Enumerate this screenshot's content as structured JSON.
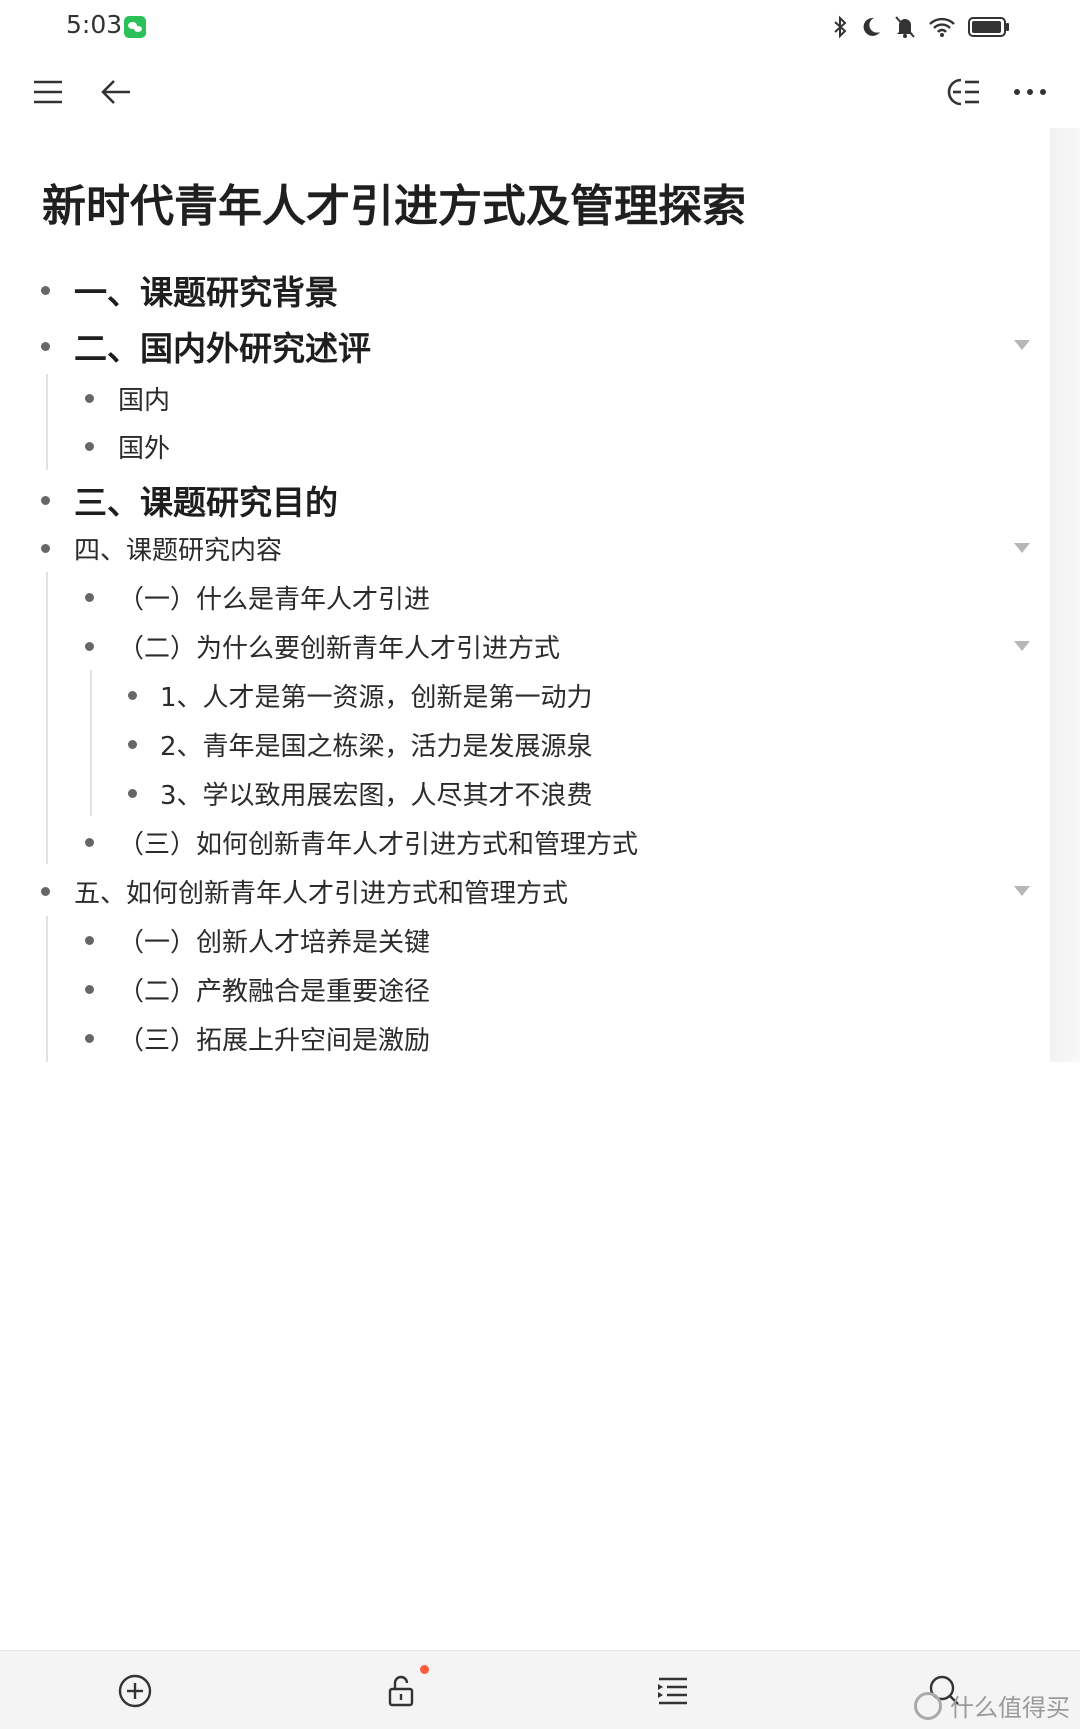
{
  "status_bar": {
    "time": "5:03",
    "app_icon": "wechat-icon",
    "icons": [
      "bluetooth-icon",
      "moon-icon",
      "mute-icon",
      "wifi-icon",
      "battery-icon"
    ]
  },
  "toolbar": {
    "left_icons": [
      "menu-icon",
      "back-arrow-icon"
    ],
    "right_icons": [
      "outline-icon",
      "more-icon"
    ]
  },
  "document": {
    "title": "新时代青年人才引进方式及管理探索",
    "items": [
      {
        "text": "一、课题研究背景"
      },
      {
        "text": "二、国内外研究述评"
      },
      {
        "text": "国内"
      },
      {
        "text": "国外"
      },
      {
        "text": "三、课题研究目的"
      },
      {
        "text": "四、课题研究内容"
      },
      {
        "text": "（一）什么是青年人才引进"
      },
      {
        "text": "（二）为什么要创新青年人才引进方式"
      },
      {
        "text": "1、人才是第一资源，创新是第一动力"
      },
      {
        "text": "2、青年是国之栋梁，活力是发展源泉"
      },
      {
        "text": "3、学以致用展宏图，人尽其才不浪费"
      },
      {
        "text": "（三）如何创新青年人才引进方式和管理方式"
      },
      {
        "text": "五、如何创新青年人才引进方式和管理方式"
      },
      {
        "text": "（一）创新人才培养是关键"
      },
      {
        "text": "（二）产教融合是重要途径"
      },
      {
        "text": "（三）拓展上升空间是激励"
      }
    ]
  },
  "bottom_bar": {
    "icons": [
      "add-icon",
      "lock-icon",
      "list-icon",
      "search-icon"
    ]
  },
  "watermark": {
    "text": "什么值得买"
  }
}
